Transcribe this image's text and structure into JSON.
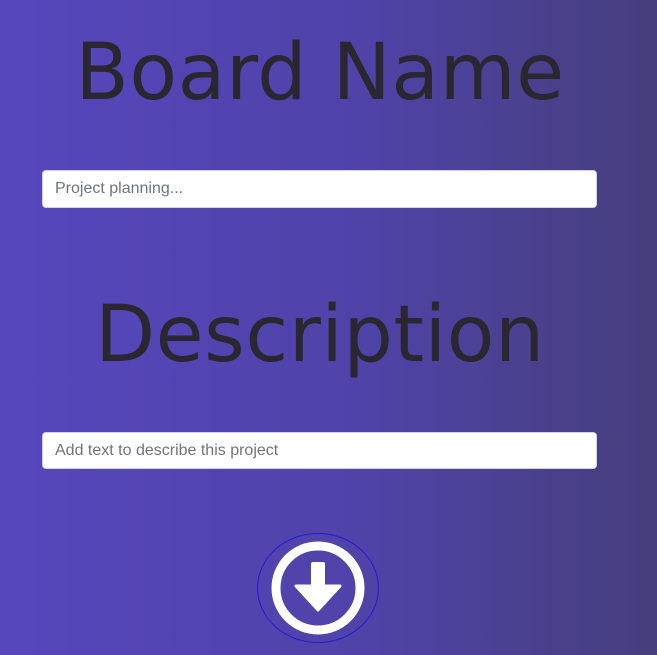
{
  "form": {
    "board_heading": "Board Name",
    "board_placeholder": "Project planning...",
    "board_value": "",
    "description_heading": "Description",
    "description_placeholder": "Add text to describe this project",
    "description_value": "",
    "submit_icon": "arrow-down-circle-icon"
  },
  "colors": {
    "background_start": "#5647bd",
    "background_end": "#463f7c",
    "heading_text": "#2a2730",
    "icon": "#ffffff",
    "button_outline": "#2a18d6"
  }
}
